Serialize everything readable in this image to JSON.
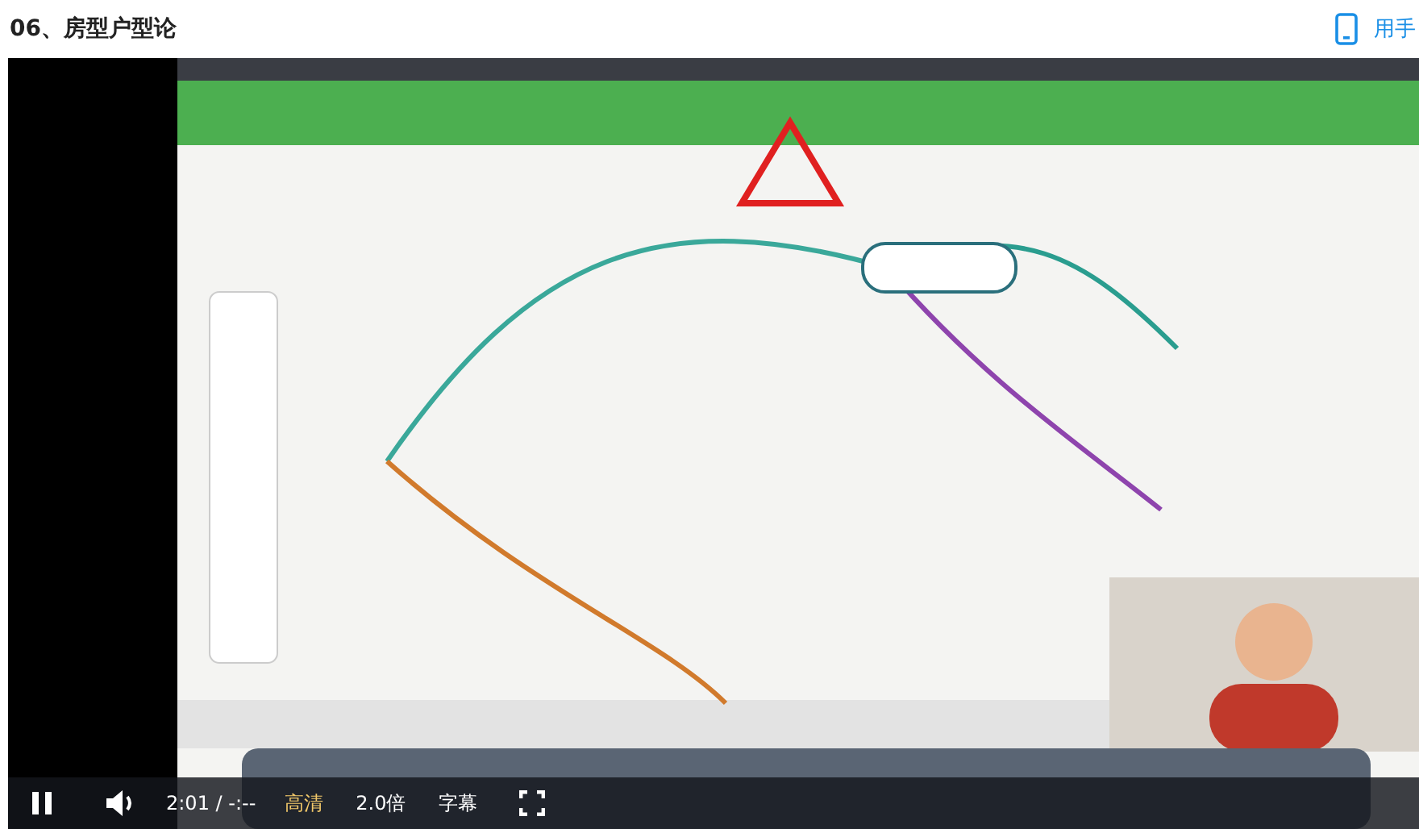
{
  "header": {
    "title": "06、房型户型论",
    "mobile_link": "用手"
  },
  "player": {
    "playing": true,
    "time": "2:01 / -:--",
    "quality": "高清",
    "speed": "2.0倍",
    "subtitles": "字幕"
  }
}
